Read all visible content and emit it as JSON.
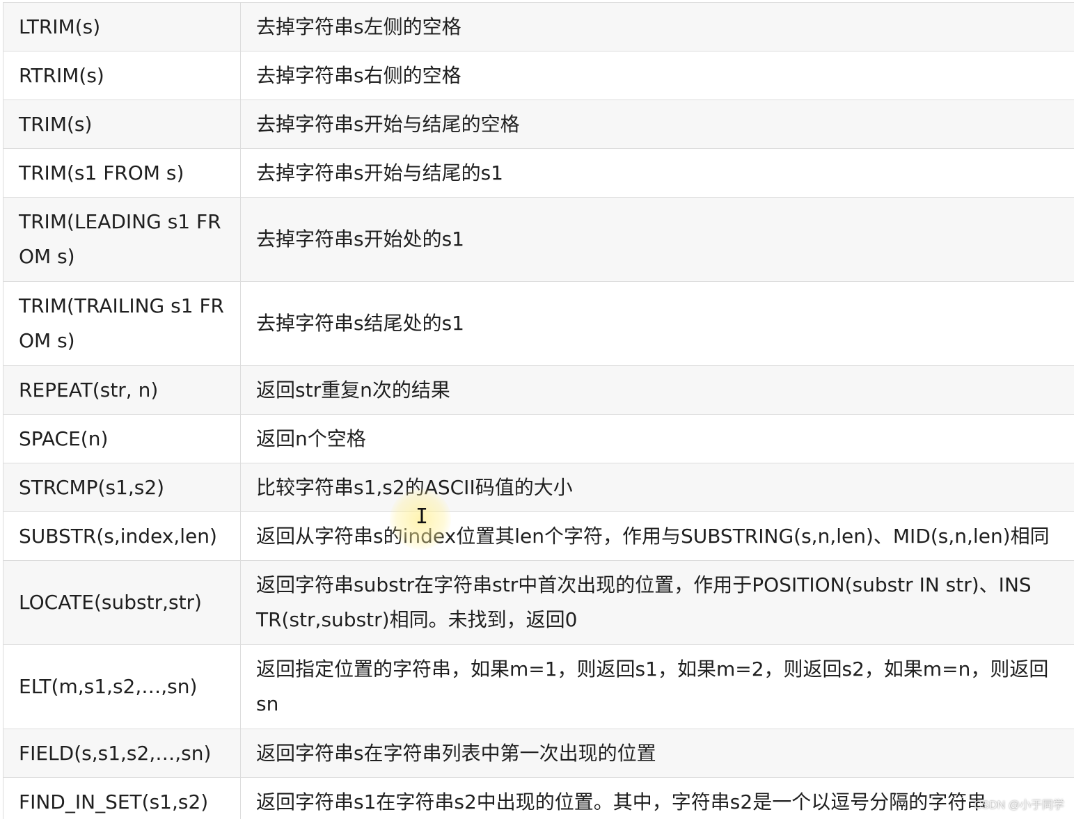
{
  "rows": [
    {
      "fn": "LTRIM(s)",
      "desc": "去掉字符串s左侧的空格"
    },
    {
      "fn": "RTRIM(s)",
      "desc": "去掉字符串s右侧的空格"
    },
    {
      "fn": "TRIM(s)",
      "desc": "去掉字符串s开始与结尾的空格"
    },
    {
      "fn": "TRIM(s1 FROM s)",
      "desc": "去掉字符串s开始与结尾的s1"
    },
    {
      "fn": "TRIM(LEADING s1 FROM s)",
      "desc": "去掉字符串s开始处的s1"
    },
    {
      "fn": "TRIM(TRAILING s1 FROM s)",
      "desc": "去掉字符串s结尾处的s1"
    },
    {
      "fn": "REPEAT(str, n)",
      "desc": "返回str重复n次的结果"
    },
    {
      "fn": "SPACE(n)",
      "desc": "返回n个空格"
    },
    {
      "fn": "STRCMP(s1,s2)",
      "desc": "比较字符串s1,s2的ASCII码值的大小"
    },
    {
      "fn": "SUBSTR(s,index,len)",
      "desc": "返回从字符串s的index位置其len个字符，作用与SUBSTRING(s,n,len)、MID(s,n,len)相同"
    },
    {
      "fn": "LOCATE(substr,str)",
      "desc": "返回字符串substr在字符串str中首次出现的位置，作用于POSITION(substr IN str)、INSTR(str,substr)相同。未找到，返回0"
    },
    {
      "fn": "ELT(m,s1,s2,…,sn)",
      "desc": "返回指定位置的字符串，如果m=1，则返回s1，如果m=2，则返回s2，如果m=n，则返回sn"
    },
    {
      "fn": "FIELD(s,s1,s2,…,sn)",
      "desc": "返回字符串s在字符串列表中第一次出现的位置"
    },
    {
      "fn": "FIND_IN_SET(s1,s2)",
      "desc": "返回字符串s1在字符串s2中出现的位置。其中，字符串s2是一个以逗号分隔的字符串"
    }
  ],
  "watermark": "CSDN @小于同学",
  "cursor": {
    "glyph": "I"
  }
}
